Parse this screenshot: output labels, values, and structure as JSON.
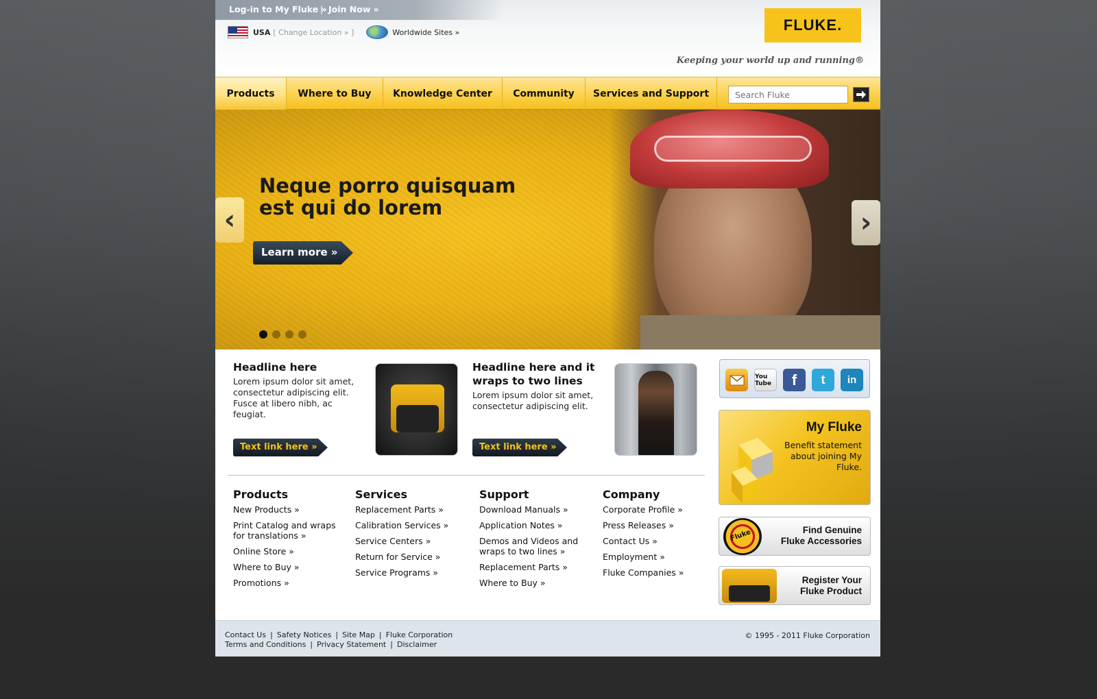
{
  "header": {
    "login_label": "Log-in to My Fluke »",
    "separator": "|",
    "join_label": "Join Now »",
    "country": "USA",
    "change_location": "[ Change Location » ]",
    "worldwide": "Worldwide Sites »",
    "logo_text": "FLUKE.",
    "tagline": "Keeping your world up and running®"
  },
  "nav": {
    "items": [
      "Products",
      "Where to Buy",
      "Knowledge Center",
      "Community",
      "Services and Support"
    ],
    "search_placeholder": "Search Fluke"
  },
  "hero": {
    "headline_line1": "Neque porro quisquam",
    "headline_line2": "est qui do lorem",
    "cta": "Learn more »",
    "slides_total": 4,
    "active_slide": 1
  },
  "features": [
    {
      "title": "Headline here",
      "body": "Lorem ipsum dolor sit amet, consectetur adipiscing elit. Fusce at libero nibh, ac feugiat.",
      "link": "Text link here »"
    },
    {
      "title": "Headline here and it wraps to two lines",
      "body": "Lorem ipsum dolor sit amet, consectetur adipiscing elit.",
      "link": "Text link here »"
    }
  ],
  "sitemap": {
    "products": {
      "title": "Products",
      "links": [
        "New Products »",
        "Print Catalog and wraps for translations »",
        "Online Store »",
        "Where to Buy »",
        "Promotions »"
      ]
    },
    "services": {
      "title": "Services",
      "links": [
        "Replacement Parts »",
        "Calibration Services »",
        "Service Centers »",
        "Return for Service »",
        "Service Programs »"
      ]
    },
    "support": {
      "title": "Support",
      "links": [
        "Download Manuals »",
        "Application Notes »",
        "Demos and Videos and wraps to two lines »",
        "Replacement Parts »",
        "Where to Buy »"
      ]
    },
    "company": {
      "title": "Company",
      "links": [
        "Corporate Profile »",
        "Press Releases »",
        "Contact Us »",
        "Employment »",
        "Fluke Companies »"
      ]
    }
  },
  "sidebar": {
    "social": [
      "email-icon",
      "youtube-icon",
      "facebook-icon",
      "twitter-icon",
      "linkedin-icon"
    ],
    "youtube_text": "You Tube",
    "myfluke_title": "My Fluke",
    "myfluke_body": "Benefit statement about joining My Fluke.",
    "seal_text": "Genuine Fluke Accessory",
    "accessories_line1": "Find Genuine",
    "accessories_line2": "Fluke Accessories",
    "register_line1": "Register Your",
    "register_line2": "Fluke Product"
  },
  "footer": {
    "row1": [
      "Contact Us",
      "Safety Notices",
      "Site Map",
      "Fluke Corporation"
    ],
    "row2": [
      "Terms and Conditions",
      "Privacy Statement",
      "Disclaimer"
    ],
    "copyright": "© 1995 - 2011 Fluke Corporation"
  },
  "colors": {
    "brand_yellow": "#f7c31a",
    "nav_dark": "#1a1a1a",
    "footer_bg": "#dde4eb"
  }
}
